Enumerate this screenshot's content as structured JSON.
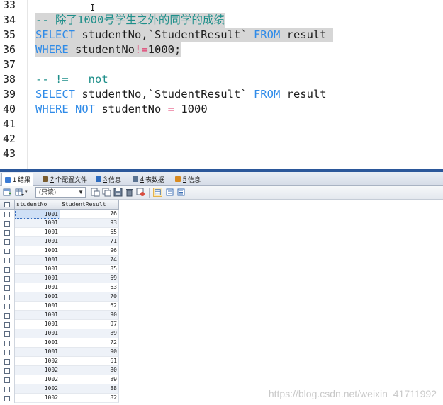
{
  "editor": {
    "line_numbers": [
      "33",
      "34",
      "35",
      "36",
      "37",
      "38",
      "39",
      "40",
      "41",
      "42",
      "43"
    ],
    "lines": [
      {
        "segments": []
      },
      {
        "selected": true,
        "segments": [
          {
            "t": "-- 除了1000号学生之外的同学的成绩",
            "c": "cm"
          }
        ]
      },
      {
        "selected": true,
        "segments": [
          {
            "t": "SELECT",
            "c": "kw"
          },
          {
            "t": " studentNo,`StudentResult` ",
            "c": ""
          },
          {
            "t": "FROM",
            "c": "kw"
          },
          {
            "t": " result ",
            "c": ""
          }
        ]
      },
      {
        "selected": true,
        "segments": [
          {
            "t": "WHERE",
            "c": "kw"
          },
          {
            "t": " studentNo",
            "c": ""
          },
          {
            "t": "!=",
            "c": "op"
          },
          {
            "t": "1000;",
            "c": ""
          }
        ]
      },
      {
        "segments": []
      },
      {
        "segments": [
          {
            "t": "-- !=   not",
            "c": "cm"
          }
        ]
      },
      {
        "segments": [
          {
            "t": "SELECT",
            "c": "kw"
          },
          {
            "t": " studentNo,`StudentResult` ",
            "c": ""
          },
          {
            "t": "FROM",
            "c": "kw"
          },
          {
            "t": " result",
            "c": ""
          }
        ]
      },
      {
        "segments": [
          {
            "t": "WHERE",
            "c": "kw"
          },
          {
            "t": " ",
            "c": ""
          },
          {
            "t": "NOT",
            "c": "kw"
          },
          {
            "t": " studentNo ",
            "c": ""
          },
          {
            "t": "=",
            "c": "op"
          },
          {
            "t": " 1000",
            "c": ""
          }
        ]
      },
      {
        "segments": []
      },
      {
        "segments": []
      },
      {
        "segments": []
      }
    ],
    "cursor_glyph": "I"
  },
  "tabs": [
    {
      "num": "1",
      "label": "结果",
      "icon": "result-table-icon",
      "icon_color": "#3a7bd5",
      "active": true
    },
    {
      "num": "2",
      "label": "个配置文件",
      "icon": "profile-icon",
      "icon_color": "#7a5c2e",
      "active": false
    },
    {
      "num": "3",
      "label": "信息",
      "icon": "info-icon",
      "icon_color": "#2d6cc0",
      "active": false
    },
    {
      "num": "4",
      "label": "表数据",
      "icon": "table-data-icon",
      "icon_color": "#5a7391",
      "active": false
    },
    {
      "num": "5",
      "label": "信息",
      "icon": "info-icon",
      "icon_color": "#d98a1f",
      "active": false
    }
  ],
  "toolbar": {
    "readonly_value": "(只读)"
  },
  "grid": {
    "columns": [
      "studentNo",
      "StudentResult"
    ],
    "rows": [
      [
        "1001",
        "76"
      ],
      [
        "1001",
        "93"
      ],
      [
        "1001",
        "65"
      ],
      [
        "1001",
        "71"
      ],
      [
        "1001",
        "96"
      ],
      [
        "1001",
        "74"
      ],
      [
        "1001",
        "85"
      ],
      [
        "1001",
        "69"
      ],
      [
        "1001",
        "63"
      ],
      [
        "1001",
        "70"
      ],
      [
        "1001",
        "62"
      ],
      [
        "1001",
        "90"
      ],
      [
        "1001",
        "97"
      ],
      [
        "1001",
        "89"
      ],
      [
        "1001",
        "72"
      ],
      [
        "1001",
        "90"
      ],
      [
        "1002",
        "61"
      ],
      [
        "1002",
        "80"
      ],
      [
        "1002",
        "89"
      ],
      [
        "1002",
        "88"
      ],
      [
        "1002",
        "82"
      ]
    ]
  },
  "watermark": "https://blog.csdn.net/weixin_41711992",
  "colors": {
    "keyword": "#2f8be8",
    "comment": "#1f8f8a",
    "operator": "#e2366a",
    "selection": "#d6d6d6",
    "splitter": "#2b579a"
  }
}
